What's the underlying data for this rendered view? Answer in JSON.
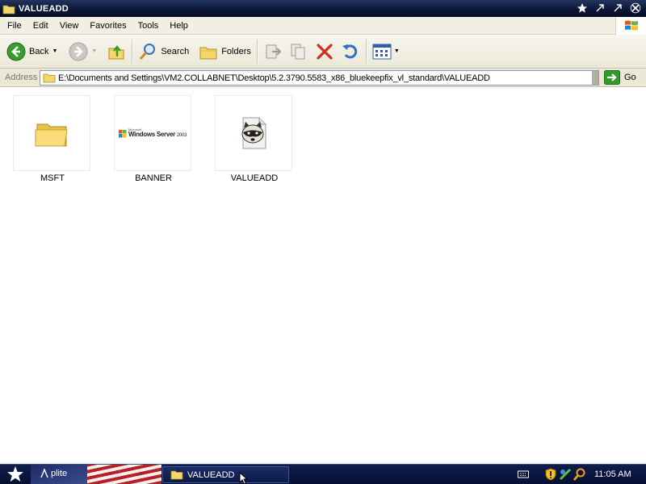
{
  "window": {
    "title": "VALUEADD"
  },
  "menu": [
    "File",
    "Edit",
    "View",
    "Favorites",
    "Tools",
    "Help"
  ],
  "toolbar": {
    "back_label": "Back",
    "search_label": "Search",
    "folders_label": "Folders"
  },
  "address": {
    "label": "Address",
    "path": "E:\\Documents and Settings\\VM2.COLLABNET\\Desktop\\5.2.3790.5583_x86_bluekeepfix_vl_standard\\VALUEADD",
    "go_label": "Go"
  },
  "files": [
    {
      "name": "MSFT",
      "icon": "folder-icon"
    },
    {
      "name": "BANNER",
      "icon": "windows-server-banner-thumbnail"
    },
    {
      "name": "VALUEADD",
      "icon": "raccoon-document-icon"
    }
  ],
  "banner_text": {
    "brand": "Microsoft",
    "product": "Windows Server",
    "year": "2003"
  },
  "taskbar": {
    "quicklaunch_label": "plite",
    "active_task": "VALUEADD",
    "clock": "11:05 AM"
  },
  "colors": {
    "titlebar": "#0b1636",
    "taskbar": "#0a1440",
    "menubar": "#f1efe2",
    "close_x": "#d62b1f",
    "go_green": "#2f9a2f"
  }
}
